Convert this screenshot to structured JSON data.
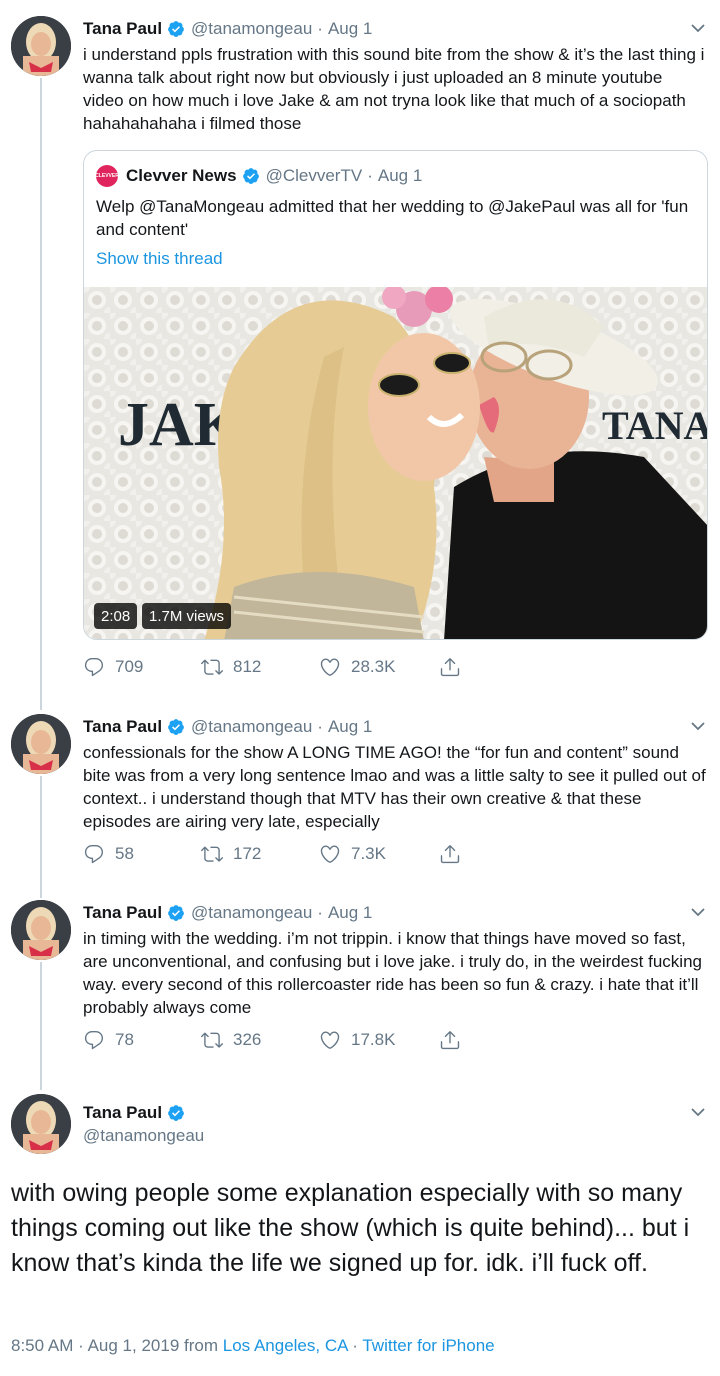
{
  "colors": {
    "link": "#1b95e0",
    "secondary_text": "#657786",
    "verified_blue": "#1da1f2",
    "brand_red": "#e0245e"
  },
  "tweets": [
    {
      "name": "Tana Paul",
      "handle": "@tanamongeau",
      "separator": "·",
      "date": "Aug 1",
      "text": "i understand ppls frustration with this sound bite from the show & it’s the last thing i wanna talk about right now but obviously i just uploaded an 8 minute youtube video on how much i love Jake & am not tryna look like that much of a sociopath hahahahahaha i filmed those",
      "replies": "709",
      "retweets": "812",
      "likes": "28.3K",
      "quote": {
        "logo_text": "CLEVVER",
        "name": "Clevver News",
        "handle": "@ClevverTV",
        "separator": "·",
        "date": "Aug 1",
        "text": "Welp @TanaMongeau admitted that her wedding to @JakePaul was all for 'fun and content'",
        "show_thread": "Show this thread",
        "duration": "2:08",
        "views": "1.7M views",
        "backdrop_left": "JAKE",
        "backdrop_right": "TANA"
      }
    },
    {
      "name": "Tana Paul",
      "handle": "@tanamongeau",
      "separator": "·",
      "date": "Aug 1",
      "text": "confessionals for the show A LONG TIME AGO! the “for fun and content” sound bite was from a very long sentence lmao and was a little salty to see it pulled out of context.. i understand though that MTV has their own creative & that these episodes are airing very late, especially",
      "replies": "58",
      "retweets": "172",
      "likes": "7.3K"
    },
    {
      "name": "Tana Paul",
      "handle": "@tanamongeau",
      "separator": "·",
      "date": "Aug 1",
      "text": "in timing with the wedding. i’m not trippin. i know that things have moved so fast, are unconventional, and confusing but i love jake. i truly do, in the weirdest fucking way. every second of this rollercoaster ride has been so fun & crazy. i hate that it’ll probably always come",
      "replies": "78",
      "retweets": "326",
      "likes": "17.8K"
    }
  ],
  "main_tweet": {
    "name": "Tana Paul",
    "handle": "@tanamongeau",
    "text": "with owing people some explanation especially with so many things coming out like the show (which is quite behind)... but i know that’s kinda the life we signed up for. idk. i’ll fuck off.",
    "time": "8:50 AM",
    "separator": "·",
    "date": "Aug 1, 2019",
    "from": "from",
    "location": "Los Angeles, CA",
    "separator2": "·",
    "client": "Twitter for iPhone"
  }
}
